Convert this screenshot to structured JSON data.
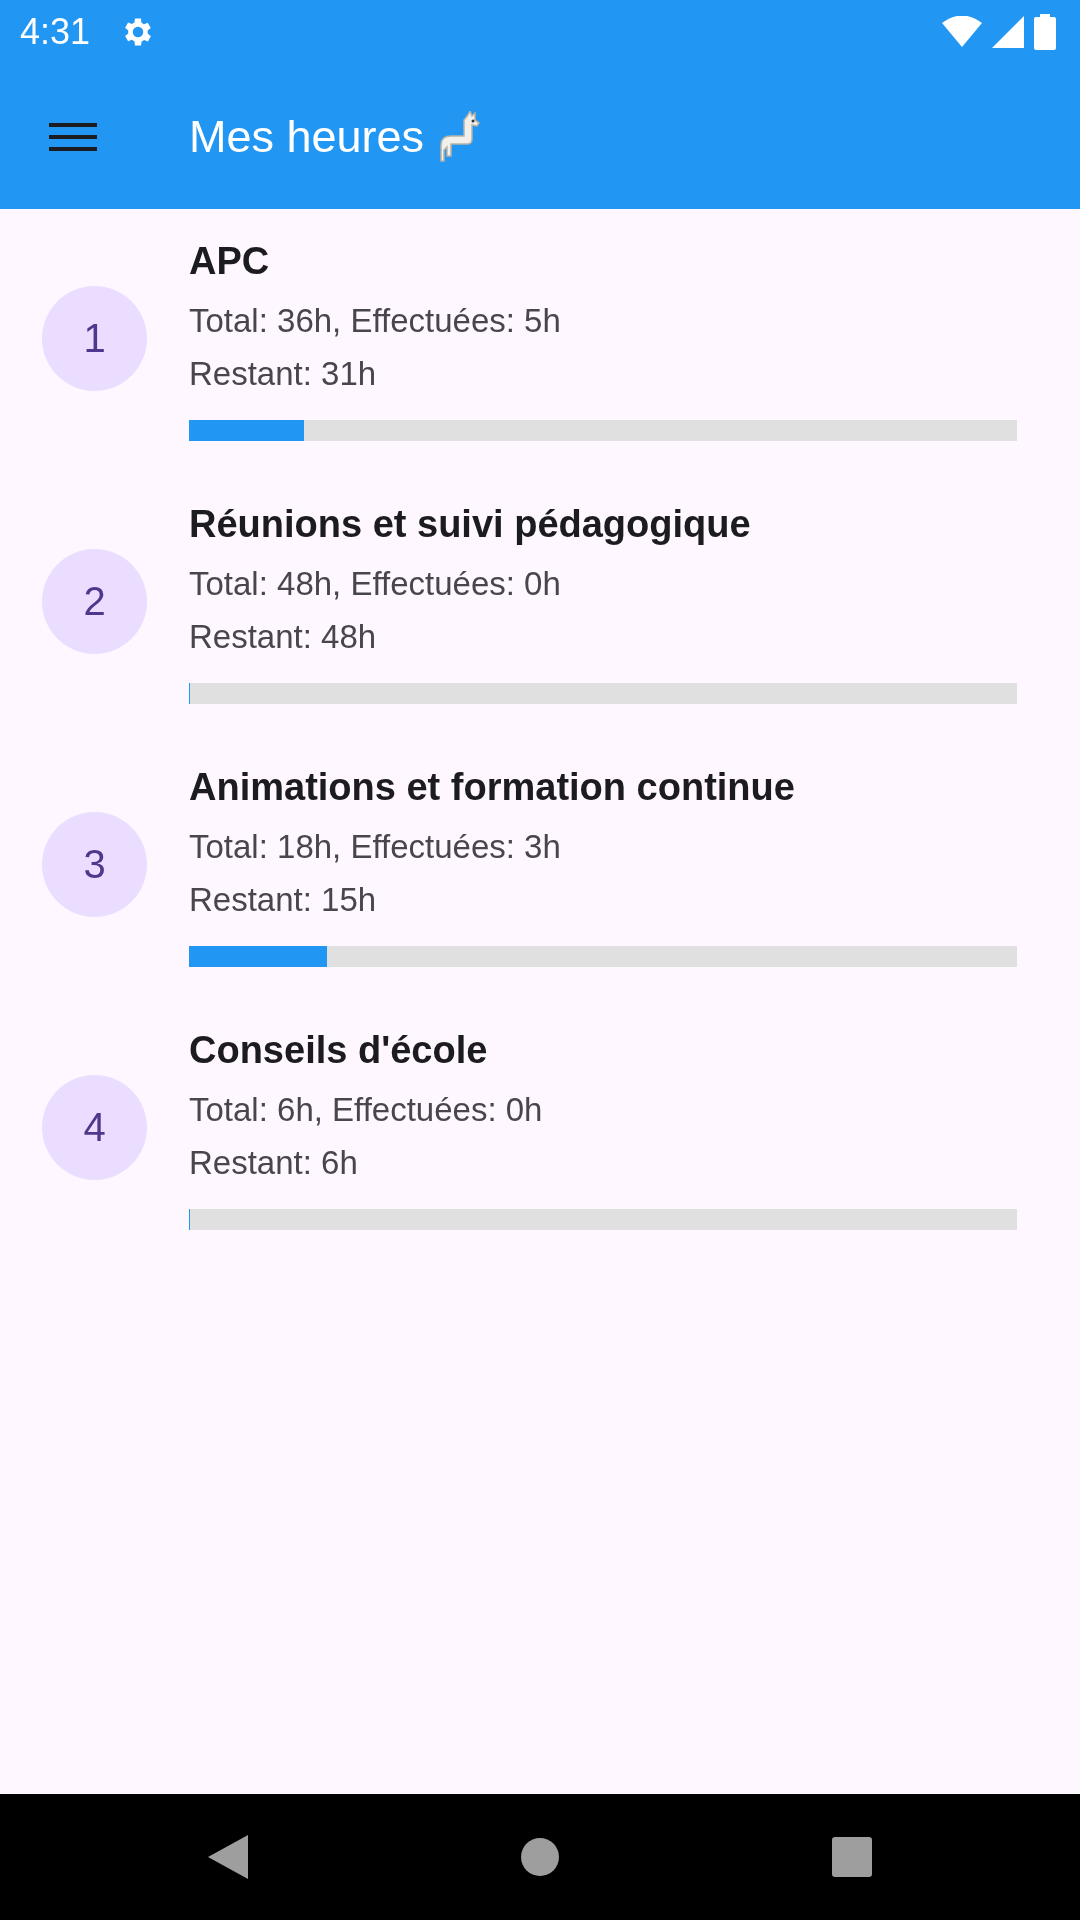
{
  "status_bar": {
    "time": "4:31"
  },
  "app_bar": {
    "title": "Mes heures"
  },
  "items": [
    {
      "number": "1",
      "title": "APC",
      "totals": "Total: 36h, Effectuées: 5h",
      "remaining": "Restant: 31h",
      "level": 0.139
    },
    {
      "number": "2",
      "title": "Réunions et suivi pédagogique",
      "totals": "Total: 48h, Effectuées: 0h",
      "remaining": "Restant: 48h",
      "level": 0
    },
    {
      "number": "3",
      "title": "Animations et formation continue",
      "totals": "Total: 18h, Effectuées: 3h",
      "remaining": "Restant: 15h",
      "level": 0.167
    },
    {
      "number": "4",
      "title": "Conseils d'école",
      "totals": "Total: 6h, Effectuées: 0h",
      "remaining": "Restant: 6h",
      "level": 0
    }
  ]
}
